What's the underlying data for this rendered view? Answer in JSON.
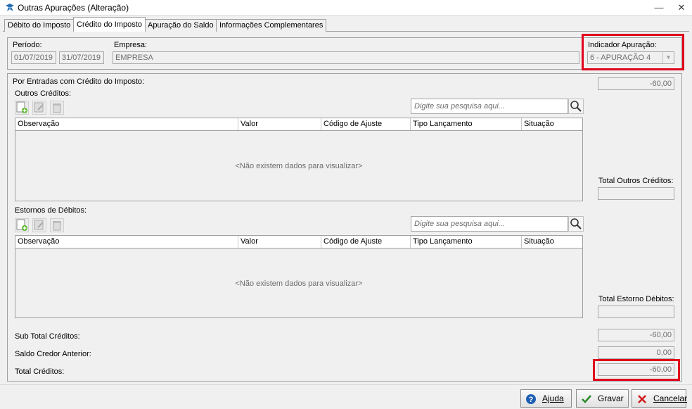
{
  "window": {
    "title": "Outras Apurações (Alteração)",
    "minimize": "—",
    "close": "✕"
  },
  "tabs": [
    {
      "label": "Débito do Imposto",
      "active": false
    },
    {
      "label": "Crédito do Imposto",
      "active": true
    },
    {
      "label": "Apuração do Saldo",
      "active": false
    },
    {
      "label": "Informações Complementares",
      "active": false
    }
  ],
  "header": {
    "periodo_label": "Período:",
    "periodo_inicio": "01/07/2019",
    "periodo_fim": "31/07/2019",
    "empresa_label": "Empresa:",
    "empresa_value": "EMPRESA",
    "indicador_label": "Indicador Apuração:",
    "indicador_value": "6 - APURAÇÃO 4"
  },
  "main": {
    "por_entradas_label": "Por Entradas com Crédito do Imposto:",
    "por_entradas_value": "-60,00",
    "outros_creditos": {
      "label": "Outros Créditos:",
      "search_placeholder": "Digite sua pesquisa aqui...",
      "columns": [
        "Observação",
        "Valor",
        "Código de Ajuste",
        "Tipo Lançamento",
        "Situação"
      ],
      "empty_message": "<Não existem dados para visualizar>",
      "total_label": "Total Outros Créditos:",
      "total_value": ""
    },
    "estornos_debitos": {
      "label": "Estornos de Débitos:",
      "search_placeholder": "Digite sua pesquisa aqui...",
      "columns": [
        "Observação",
        "Valor",
        "Código de Ajuste",
        "Tipo Lançamento",
        "Situação"
      ],
      "empty_message": "<Não existem dados para visualizar>",
      "total_label": "Total Estorno Débitos:",
      "total_value": ""
    },
    "sub_total_label": "Sub Total Créditos:",
    "sub_total_value": "-60,00",
    "saldo_credor_label": "Saldo Credor Anterior:",
    "saldo_credor_value": "0,00",
    "total_creditos_label": "Total Créditos:",
    "total_creditos_value": "-60,00"
  },
  "footer": {
    "ajuda": "Ajuda",
    "gravar": "Gravar",
    "cancelar": "Cancelar"
  },
  "colors": {
    "highlight": "#e0001b",
    "help_icon": "#1e5fb4",
    "save_icon": "#2a8a2a",
    "cancel_icon": "#d01818"
  },
  "icons": [
    "app-icon",
    "add-icon",
    "edit-icon",
    "delete-icon",
    "search-icon",
    "help-icon",
    "check-icon",
    "x-icon",
    "dropdown-arrow-icon"
  ]
}
